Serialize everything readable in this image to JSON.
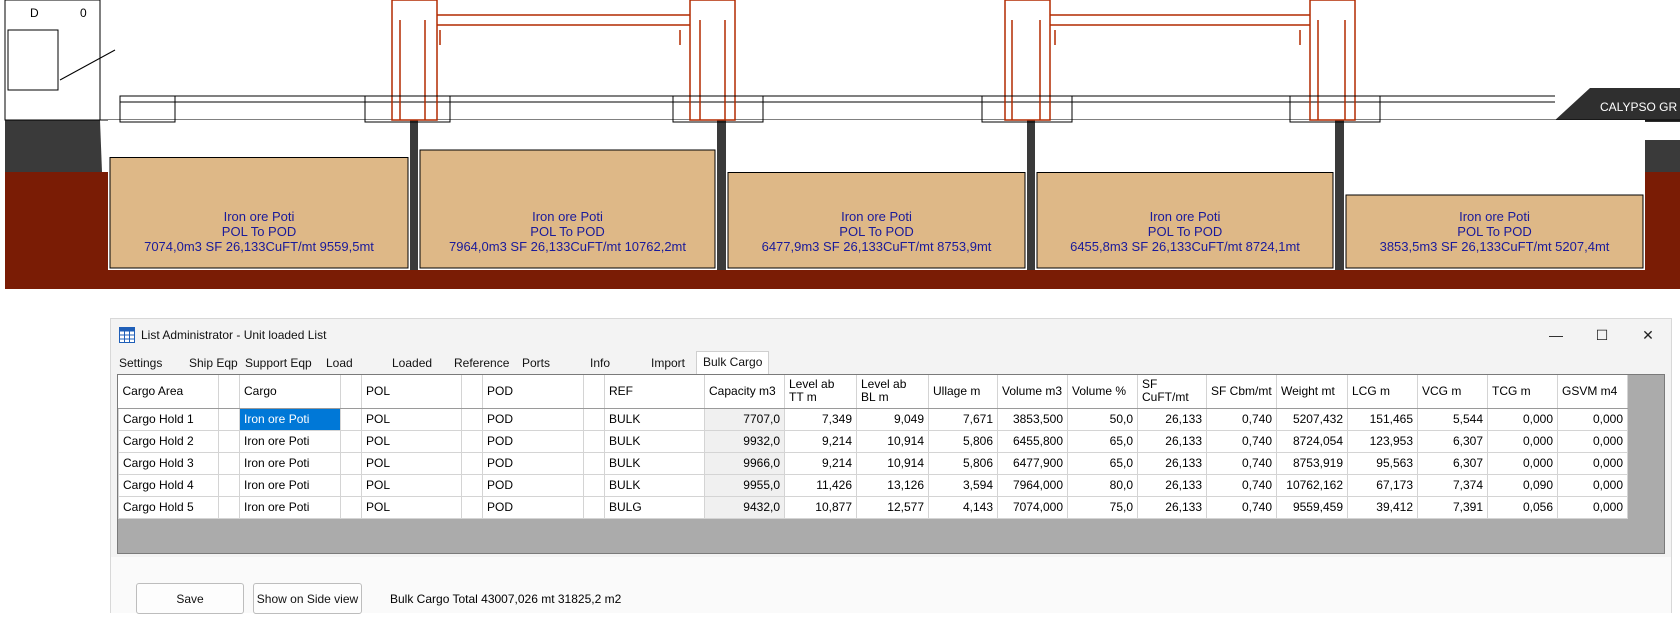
{
  "ship_view": {
    "corner_label_left": "D",
    "corner_label_right": "0",
    "vessel_name": "CALYPSO GR",
    "holds": [
      {
        "cargo": "Iron ore Poti",
        "route": "POL To POD",
        "detail": "7074,0m3 SF 26,133CuFT/mt 9559,5mt",
        "fill_fraction": 0.75
      },
      {
        "cargo": "Iron ore Poti",
        "route": "POL To POD",
        "detail": "7964,0m3 SF 26,133CuFT/mt 10762,2mt",
        "fill_fraction": 0.8
      },
      {
        "cargo": "Iron ore Poti",
        "route": "POL To POD",
        "detail": "6477,9m3 SF 26,133CuFT/mt 8753,9mt",
        "fill_fraction": 0.65
      },
      {
        "cargo": "Iron ore Poti",
        "route": "POL To POD",
        "detail": "6455,8m3 SF 26,133CuFT/mt 8724,1mt",
        "fill_fraction": 0.65
      },
      {
        "cargo": "Iron ore Poti",
        "route": "POL To POD",
        "detail": "3853,5m3 SF 26,133CuFT/mt 5207,4mt",
        "fill_fraction": 0.5
      }
    ],
    "colors": {
      "cargo_fill": "#deb887",
      "hull_bottom": "#7a1c05",
      "hull_dark": "#3a3a3a",
      "crane": "#b22a00",
      "label": "#1a1a9a"
    }
  },
  "window": {
    "title": "List Administrator - Unit loaded List",
    "controls": {
      "minimize": "—",
      "maximize": "☐",
      "close": "✕"
    },
    "icon": "table-grid-icon",
    "tabs": [
      "Settings",
      "Ship Eqp",
      "Support Eqp",
      "Load",
      "Loaded",
      "Reference",
      "Ports",
      "Info",
      "Import",
      "Bulk Cargo"
    ],
    "active_tab": "Bulk Cargo"
  },
  "table": {
    "headers": [
      "Cargo Area",
      "",
      "Cargo",
      "",
      "POL",
      "",
      "POD",
      "",
      "REF",
      "Capacity m3",
      "Level ab TT m",
      "Level ab BL m",
      "Ullage m",
      "Volume m3",
      "Volume %",
      "SF CuFT/mt",
      "SF Cbm/mt",
      "Weight mt",
      "LCG m",
      "VCG m",
      "TCG m",
      "GSVM m4"
    ],
    "rows": [
      [
        "Cargo Hold 1",
        "",
        "Iron ore Poti",
        "",
        "POL",
        "",
        "POD",
        "",
        "BULK",
        "7707,0",
        "7,349",
        "9,049",
        "7,671",
        "3853,500",
        "50,0",
        "26,133",
        "0,740",
        "5207,432",
        "151,465",
        "5,544",
        "0,000",
        "0,000"
      ],
      [
        "Cargo Hold 2",
        "",
        "Iron ore Poti",
        "",
        "POL",
        "",
        "POD",
        "",
        "BULK",
        "9932,0",
        "9,214",
        "10,914",
        "5,806",
        "6455,800",
        "65,0",
        "26,133",
        "0,740",
        "8724,054",
        "123,953",
        "6,307",
        "0,000",
        "0,000"
      ],
      [
        "Cargo Hold 3",
        "",
        "Iron ore Poti",
        "",
        "POL",
        "",
        "POD",
        "",
        "BULK",
        "9966,0",
        "9,214",
        "10,914",
        "5,806",
        "6477,900",
        "65,0",
        "26,133",
        "0,740",
        "8753,919",
        "95,563",
        "6,307",
        "0,000",
        "0,000"
      ],
      [
        "Cargo Hold 4",
        "",
        "Iron ore Poti",
        "",
        "POL",
        "",
        "POD",
        "",
        "BULK",
        "9955,0",
        "11,426",
        "13,126",
        "3,594",
        "7964,000",
        "80,0",
        "26,133",
        "0,740",
        "10762,162",
        "67,173",
        "7,374",
        "0,090",
        "0,000"
      ],
      [
        "Cargo Hold 5",
        "",
        "Iron ore Poti",
        "",
        "POL",
        "",
        "POD",
        "",
        "BULG",
        "9432,0",
        "10,877",
        "12,577",
        "4,143",
        "7074,000",
        "75,0",
        "26,133",
        "0,740",
        "9559,459",
        "39,412",
        "7,391",
        "0,056",
        "0,000"
      ]
    ]
  },
  "footer": {
    "save_label": "Save",
    "show_label": "Show on Side view",
    "total_text": "Bulk Cargo Total 43007,026 mt 31825,2 m2"
  }
}
